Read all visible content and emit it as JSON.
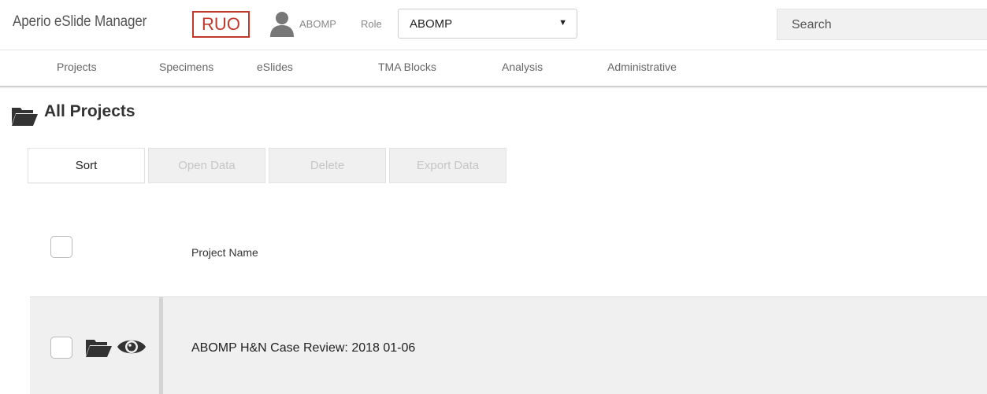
{
  "header": {
    "app_title": "Aperio eSlide Manager",
    "ruo_badge": "RUO",
    "user_name": "ABOMP",
    "role_label": "Role",
    "role_value": "ABOMP",
    "search_placeholder": "Search"
  },
  "nav": {
    "items": [
      {
        "label": "Projects"
      },
      {
        "label": "Specimens"
      },
      {
        "label": "eSlides"
      },
      {
        "label": "TMA Blocks"
      },
      {
        "label": "Analysis"
      },
      {
        "label": "Administrative"
      }
    ]
  },
  "page": {
    "title": "All Projects"
  },
  "toolbar": {
    "sort": "Sort",
    "open_data": "Open Data",
    "delete": "Delete",
    "export_data": "Export Data"
  },
  "table": {
    "column_project_name": "Project Name",
    "rows": [
      {
        "project_name": "ABOMP H&N Case Review: 2018 01-06"
      }
    ]
  },
  "colors": {
    "ruo_red": "#c0392b",
    "icon_dark": "#333333",
    "row_bg": "#f0f0f0"
  },
  "icons": {
    "user": "user-icon",
    "title_folder": "folder-open-icon",
    "row_folder": "folder-open-icon",
    "row_view": "eye-icon"
  }
}
